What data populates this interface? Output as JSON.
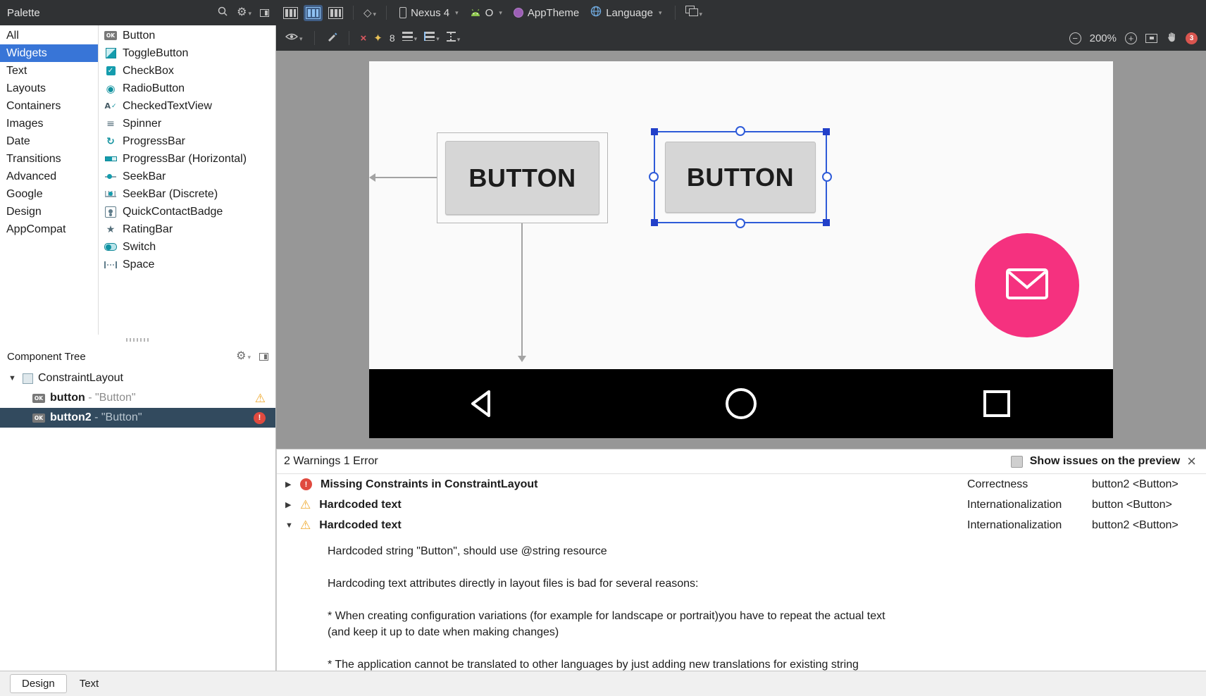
{
  "top_toolbar": {
    "palette_title": "Palette",
    "device_label": "Nexus 4",
    "api_label": "O",
    "theme_label": "AppTheme",
    "language_label": "Language"
  },
  "design_toolbar": {
    "default_margin": "8",
    "zoom_level": "200%",
    "issue_badge": "3"
  },
  "palette": {
    "categories": [
      "All",
      "Widgets",
      "Text",
      "Layouts",
      "Containers",
      "Images",
      "Date",
      "Transitions",
      "Advanced",
      "Google",
      "Design",
      "AppCompat"
    ],
    "selected_category": "Widgets",
    "widgets": [
      "Button",
      "ToggleButton",
      "CheckBox",
      "RadioButton",
      "CheckedTextView",
      "Spinner",
      "ProgressBar",
      "ProgressBar (Horizontal)",
      "SeekBar",
      "SeekBar (Discrete)",
      "QuickContactBadge",
      "RatingBar",
      "Switch",
      "Space"
    ]
  },
  "component_tree": {
    "title": "Component Tree",
    "root_label": "ConstraintLayout",
    "items": [
      {
        "name": "button",
        "suffix": " - \"Button\"",
        "status": "warning"
      },
      {
        "name": "button2",
        "suffix": " - \"Button\"",
        "status": "error",
        "selected": true
      }
    ]
  },
  "canvas": {
    "button1_label": "BUTTON",
    "button2_label": "BUTTON"
  },
  "issues": {
    "header": "2 Warnings 1 Error",
    "show_on_preview_label": "Show issues on the preview",
    "rows": [
      {
        "title": "Missing Constraints in ConstraintLayout",
        "category": "Correctness",
        "component": "button2 <Button>",
        "severity": "error",
        "expanded": false
      },
      {
        "title": "Hardcoded text",
        "category": "Internationalization",
        "component": "button <Button>",
        "severity": "warning",
        "expanded": false
      },
      {
        "title": "Hardcoded text",
        "category": "Internationalization",
        "component": "button2 <Button>",
        "severity": "warning",
        "expanded": true
      }
    ],
    "detail_lines": [
      "Hardcoded string \"Button\", should use @string resource",
      "",
      "Hardcoding text attributes directly in layout files is bad for several reasons:",
      "",
      "* When creating configuration variations (for example for landscape or portrait)you have to repeat the actual text",
      "(and keep it up to date when making changes)",
      "",
      "* The application cannot be translated to other languages by just adding new translations for existing string"
    ]
  },
  "tabs": {
    "design": "Design",
    "text": "Text"
  },
  "colors": {
    "accent_pink": "#F5317F",
    "selection_blue": "#2E5BD8",
    "warning": "#EFA92F",
    "error": "#E04A3F",
    "category_selected": "#3875D7"
  }
}
